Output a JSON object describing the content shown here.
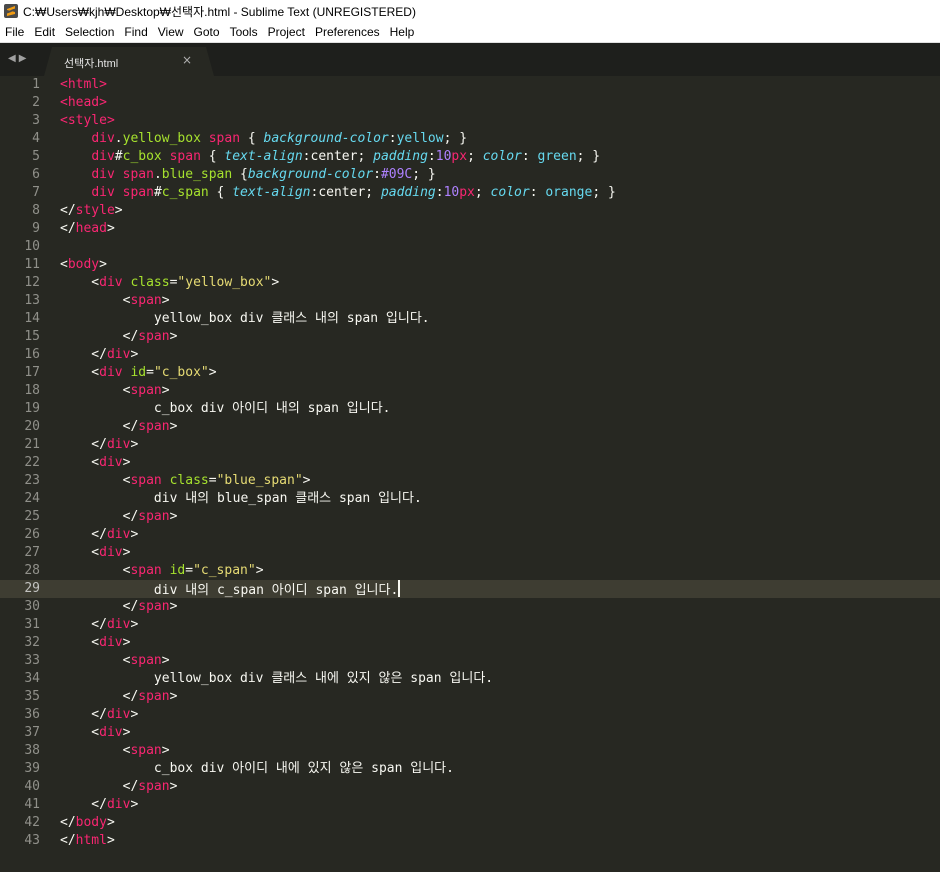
{
  "window": {
    "title": "C:₩Users₩kjh₩Desktop₩선택자.html - Sublime Text (UNREGISTERED)"
  },
  "menu": [
    "File",
    "Edit",
    "Selection",
    "Find",
    "View",
    "Goto",
    "Tools",
    "Project",
    "Preferences",
    "Help"
  ],
  "tabnav": "◀▶",
  "tab": {
    "label": "선택자.html",
    "close": "×"
  },
  "editor": {
    "current_line": 29,
    "lines": [
      [
        [
          "t",
          "<"
        ],
        [
          "t",
          "html"
        ],
        [
          "t",
          ">"
        ]
      ],
      [
        [
          "t",
          "<"
        ],
        [
          "t",
          "head"
        ],
        [
          "t",
          ">"
        ]
      ],
      [
        [
          "t",
          "<"
        ],
        [
          "t",
          "style"
        ],
        [
          "t",
          ">"
        ]
      ],
      [
        [
          "w",
          "    "
        ],
        [
          "t",
          "div"
        ],
        [
          "w",
          "."
        ],
        [
          "a",
          "yellow_box"
        ],
        [
          "w",
          " "
        ],
        [
          "t",
          "span"
        ],
        [
          "w",
          " { "
        ],
        [
          "p",
          "background-color"
        ],
        [
          "w",
          ":"
        ],
        [
          "v",
          "yellow"
        ],
        [
          "w",
          "; }"
        ]
      ],
      [
        [
          "w",
          "    "
        ],
        [
          "t",
          "div"
        ],
        [
          "w",
          "#"
        ],
        [
          "a",
          "c_box"
        ],
        [
          "w",
          " "
        ],
        [
          "t",
          "span"
        ],
        [
          "w",
          " { "
        ],
        [
          "p",
          "text-align"
        ],
        [
          "w",
          ":"
        ],
        [
          "w",
          "center"
        ],
        [
          "w",
          "; "
        ],
        [
          "p",
          "padding"
        ],
        [
          "w",
          ":"
        ],
        [
          "n",
          "10"
        ],
        [
          "t",
          "px"
        ],
        [
          "w",
          "; "
        ],
        [
          "p",
          "color"
        ],
        [
          "w",
          ": "
        ],
        [
          "v",
          "green"
        ],
        [
          "w",
          "; }"
        ]
      ],
      [
        [
          "w",
          "    "
        ],
        [
          "t",
          "div"
        ],
        [
          "w",
          " "
        ],
        [
          "t",
          "span"
        ],
        [
          "w",
          "."
        ],
        [
          "a",
          "blue_span"
        ],
        [
          "w",
          " {"
        ],
        [
          "p",
          "background-color"
        ],
        [
          "w",
          ":"
        ],
        [
          "n",
          "#09C"
        ],
        [
          "w",
          "; }"
        ]
      ],
      [
        [
          "w",
          "    "
        ],
        [
          "t",
          "div"
        ],
        [
          "w",
          " "
        ],
        [
          "t",
          "span"
        ],
        [
          "w",
          "#"
        ],
        [
          "a",
          "c_span"
        ],
        [
          "w",
          " { "
        ],
        [
          "p",
          "text-align"
        ],
        [
          "w",
          ":"
        ],
        [
          "w",
          "center"
        ],
        [
          "w",
          "; "
        ],
        [
          "p",
          "padding"
        ],
        [
          "w",
          ":"
        ],
        [
          "n",
          "10"
        ],
        [
          "t",
          "px"
        ],
        [
          "w",
          "; "
        ],
        [
          "p",
          "color"
        ],
        [
          "w",
          ": "
        ],
        [
          "v",
          "orange"
        ],
        [
          "w",
          "; }"
        ]
      ],
      [
        [
          "w",
          "</"
        ],
        [
          "t",
          "style"
        ],
        [
          "w",
          ">"
        ]
      ],
      [
        [
          "w",
          "</"
        ],
        [
          "t",
          "head"
        ],
        [
          "w",
          ">"
        ]
      ],
      [],
      [
        [
          "w",
          "<"
        ],
        [
          "t",
          "body"
        ],
        [
          "w",
          ">"
        ]
      ],
      [
        [
          "w",
          "    <"
        ],
        [
          "t",
          "div"
        ],
        [
          "w",
          " "
        ],
        [
          "a",
          "class"
        ],
        [
          "w",
          "="
        ],
        [
          "s",
          "\"yellow_box\""
        ],
        [
          "w",
          ">"
        ]
      ],
      [
        [
          "w",
          "        <"
        ],
        [
          "t",
          "span"
        ],
        [
          "w",
          ">"
        ]
      ],
      [
        [
          "w",
          "            yellow_box div 클래스 내의 span 입니다."
        ]
      ],
      [
        [
          "w",
          "        </"
        ],
        [
          "t",
          "span"
        ],
        [
          "w",
          ">"
        ]
      ],
      [
        [
          "w",
          "    </"
        ],
        [
          "t",
          "div"
        ],
        [
          "w",
          ">"
        ]
      ],
      [
        [
          "w",
          "    <"
        ],
        [
          "t",
          "div"
        ],
        [
          "w",
          " "
        ],
        [
          "a",
          "id"
        ],
        [
          "w",
          "="
        ],
        [
          "s",
          "\"c_box\""
        ],
        [
          "w",
          ">"
        ]
      ],
      [
        [
          "w",
          "        <"
        ],
        [
          "t",
          "span"
        ],
        [
          "w",
          ">"
        ]
      ],
      [
        [
          "w",
          "            c_box div 아이디 내의 span 입니다."
        ]
      ],
      [
        [
          "w",
          "        </"
        ],
        [
          "t",
          "span"
        ],
        [
          "w",
          ">"
        ]
      ],
      [
        [
          "w",
          "    </"
        ],
        [
          "t",
          "div"
        ],
        [
          "w",
          ">"
        ]
      ],
      [
        [
          "w",
          "    <"
        ],
        [
          "t",
          "div"
        ],
        [
          "w",
          ">"
        ]
      ],
      [
        [
          "w",
          "        <"
        ],
        [
          "t",
          "span"
        ],
        [
          "w",
          " "
        ],
        [
          "a",
          "class"
        ],
        [
          "w",
          "="
        ],
        [
          "s",
          "\"blue_span\""
        ],
        [
          "w",
          ">"
        ]
      ],
      [
        [
          "w",
          "            div 내의 blue_span 클래스 span 입니다."
        ]
      ],
      [
        [
          "w",
          "        </"
        ],
        [
          "t",
          "span"
        ],
        [
          "w",
          ">"
        ]
      ],
      [
        [
          "w",
          "    </"
        ],
        [
          "t",
          "div"
        ],
        [
          "w",
          ">"
        ]
      ],
      [
        [
          "w",
          "    <"
        ],
        [
          "t",
          "div"
        ],
        [
          "w",
          ">"
        ]
      ],
      [
        [
          "w",
          "        <"
        ],
        [
          "t",
          "span"
        ],
        [
          "w",
          " "
        ],
        [
          "a",
          "id"
        ],
        [
          "w",
          "="
        ],
        [
          "s",
          "\"c_span\""
        ],
        [
          "w",
          ">"
        ]
      ],
      [
        [
          "w",
          "            div 내의 c_span 아이디 span 입니다."
        ]
      ],
      [
        [
          "w",
          "        </"
        ],
        [
          "t",
          "span"
        ],
        [
          "w",
          ">"
        ]
      ],
      [
        [
          "w",
          "    </"
        ],
        [
          "t",
          "div"
        ],
        [
          "w",
          ">"
        ]
      ],
      [
        [
          "w",
          "    <"
        ],
        [
          "t",
          "div"
        ],
        [
          "w",
          ">"
        ]
      ],
      [
        [
          "w",
          "        <"
        ],
        [
          "t",
          "span"
        ],
        [
          "w",
          ">"
        ]
      ],
      [
        [
          "w",
          "            yellow_box div 클래스 내에 있지 않은 span 입니다."
        ]
      ],
      [
        [
          "w",
          "        </"
        ],
        [
          "t",
          "span"
        ],
        [
          "w",
          ">"
        ]
      ],
      [
        [
          "w",
          "    </"
        ],
        [
          "t",
          "div"
        ],
        [
          "w",
          ">"
        ]
      ],
      [
        [
          "w",
          "    <"
        ],
        [
          "t",
          "div"
        ],
        [
          "w",
          ">"
        ]
      ],
      [
        [
          "w",
          "        <"
        ],
        [
          "t",
          "span"
        ],
        [
          "w",
          ">"
        ]
      ],
      [
        [
          "w",
          "            c_box div 아이디 내에 있지 않은 span 입니다."
        ]
      ],
      [
        [
          "w",
          "        </"
        ],
        [
          "t",
          "span"
        ],
        [
          "w",
          ">"
        ]
      ],
      [
        [
          "w",
          "    </"
        ],
        [
          "t",
          "div"
        ],
        [
          "w",
          ">"
        ]
      ],
      [
        [
          "w",
          "</"
        ],
        [
          "t",
          "body"
        ],
        [
          "w",
          ">"
        ]
      ],
      [
        [
          "w",
          "</"
        ],
        [
          "t",
          "html"
        ],
        [
          "w",
          ">"
        ]
      ]
    ]
  },
  "colors": {
    "background": "#272822",
    "tag": "#f92672",
    "attribute": "#a6e22e",
    "string": "#e6db74",
    "property": "#66d9ef",
    "number": "#ae81ff",
    "text": "#f8f8f2"
  }
}
